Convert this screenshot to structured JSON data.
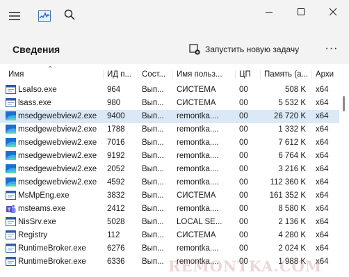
{
  "window": {
    "controls": {
      "minimize": "—",
      "maximize": "☐",
      "close": "✕"
    }
  },
  "header": {
    "title": "Сведения",
    "run_task_label": "Запустить новую задачу",
    "more_label": "···"
  },
  "columns": {
    "name": "Имя",
    "pid": "ИД п...",
    "status": "Сост...",
    "user": "Имя польз...",
    "cpu": "ЦП",
    "memory": "Память (а...",
    "arch": "Архи"
  },
  "rows": [
    {
      "icon": "process-window-icon",
      "name": "LsaIso.exe",
      "pid": "964",
      "status": "Вып...",
      "user": "СИСТЕМА",
      "cpu": "00",
      "memory": "508 K",
      "arch": "x64"
    },
    {
      "icon": "process-window-icon",
      "name": "lsass.exe",
      "pid": "980",
      "status": "Вып...",
      "user": "СИСТЕМА",
      "cpu": "00",
      "memory": "5 532 K",
      "arch": "x64"
    },
    {
      "icon": "edge-webview-icon",
      "name": "msedgewebview2.exe",
      "pid": "9400",
      "status": "Вып...",
      "user": "remontka....",
      "cpu": "00",
      "memory": "26 720 K",
      "arch": "x64",
      "selected": true
    },
    {
      "icon": "edge-webview-icon",
      "name": "msedgewebview2.exe",
      "pid": "1788",
      "status": "Вып...",
      "user": "remontka....",
      "cpu": "00",
      "memory": "1 332 K",
      "arch": "x64"
    },
    {
      "icon": "edge-webview-icon",
      "name": "msedgewebview2.exe",
      "pid": "7016",
      "status": "Вып...",
      "user": "remontka....",
      "cpu": "00",
      "memory": "7 612 K",
      "arch": "x64"
    },
    {
      "icon": "edge-webview-icon",
      "name": "msedgewebview2.exe",
      "pid": "9192",
      "status": "Вып...",
      "user": "remontka....",
      "cpu": "00",
      "memory": "6 764 K",
      "arch": "x64"
    },
    {
      "icon": "edge-webview-icon",
      "name": "msedgewebview2.exe",
      "pid": "2052",
      "status": "Вып...",
      "user": "remontka....",
      "cpu": "00",
      "memory": "3 216 K",
      "arch": "x64"
    },
    {
      "icon": "edge-webview-icon",
      "name": "msedgewebview2.exe",
      "pid": "4592",
      "status": "Вып...",
      "user": "remontka....",
      "cpu": "00",
      "memory": "112 360 K",
      "arch": "x64"
    },
    {
      "icon": "process-window-icon",
      "name": "MsMpEng.exe",
      "pid": "3832",
      "status": "Вып...",
      "user": "СИСТЕМА",
      "cpu": "00",
      "memory": "161 352 K",
      "arch": "x64"
    },
    {
      "icon": "teams-icon",
      "name": "msteams.exe",
      "pid": "2412",
      "status": "Вып...",
      "user": "remontka....",
      "cpu": "00",
      "memory": "8 580 K",
      "arch": "x64"
    },
    {
      "icon": "process-window-icon",
      "name": "NisSrv.exe",
      "pid": "5028",
      "status": "Вып...",
      "user": "LOCAL SE...",
      "cpu": "00",
      "memory": "2 136 K",
      "arch": "x64"
    },
    {
      "icon": "process-window-icon",
      "name": "Registry",
      "pid": "112",
      "status": "Вып...",
      "user": "СИСТЕМА",
      "cpu": "00",
      "memory": "4 280 K",
      "arch": "x64"
    },
    {
      "icon": "process-window-icon",
      "name": "RuntimeBroker.exe",
      "pid": "6276",
      "status": "Вып...",
      "user": "remontka....",
      "cpu": "00",
      "memory": "2 024 K",
      "arch": "x64"
    },
    {
      "icon": "process-window-icon",
      "name": "RuntimeBroker.exe",
      "pid": "6336",
      "status": "Вып...",
      "user": "remontka....",
      "cpu": "00",
      "memory": "1 988 K",
      "arch": "x64"
    }
  ],
  "watermark": "REMONTKA.COM",
  "colors": {
    "selected_row": "#dbe9f7",
    "chrome_bg": "#f3f3f3",
    "edge_icon": "#1a6fd0"
  }
}
